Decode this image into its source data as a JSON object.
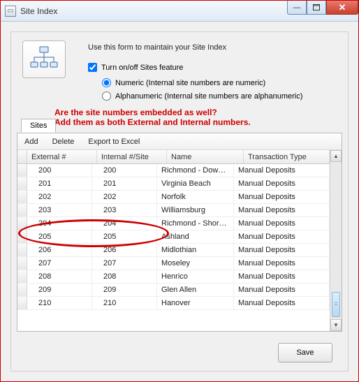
{
  "window": {
    "title": "Site Index"
  },
  "header": {
    "instruction": "Use this form to maintain your Site Index",
    "checkbox_label": "Turn on/off Sites feature",
    "checkbox_checked": true,
    "radio_numeric": "Numeric (Internal site numbers are numeric)",
    "radio_alpha": "Alphanumeric (Internal site numbers are alphanumeric)",
    "radio_selected": "numeric"
  },
  "annotation": {
    "line1": "Are the site numbers embedded as well?",
    "line2": "Add them as both External and Internal numbers."
  },
  "tabs": {
    "sites": "Sites"
  },
  "toolbar": {
    "add": "Add",
    "delete": "Delete",
    "export": "Export to Excel"
  },
  "columns": {
    "ext": "External #",
    "int": "Internal #/Site",
    "name": "Name",
    "tt": "Transaction Type"
  },
  "rows": [
    {
      "ext": "200",
      "int": "200",
      "name": "Richmond - Dow…",
      "tt": "Manual Deposits"
    },
    {
      "ext": "201",
      "int": "201",
      "name": "Virginia Beach",
      "tt": "Manual Deposits"
    },
    {
      "ext": "202",
      "int": "202",
      "name": "Norfolk",
      "tt": "Manual Deposits"
    },
    {
      "ext": "203",
      "int": "203",
      "name": "Williamsburg",
      "tt": "Manual Deposits"
    },
    {
      "ext": "204",
      "int": "204",
      "name": "Richmond - Shor…",
      "tt": "Manual Deposits"
    },
    {
      "ext": "205",
      "int": "205",
      "name": "Ashland",
      "tt": "Manual Deposits"
    },
    {
      "ext": "206",
      "int": "206",
      "name": "Midlothian",
      "tt": "Manual Deposits"
    },
    {
      "ext": "207",
      "int": "207",
      "name": "Moseley",
      "tt": "Manual Deposits"
    },
    {
      "ext": "208",
      "int": "208",
      "name": "Henrico",
      "tt": "Manual Deposits"
    },
    {
      "ext": "209",
      "int": "209",
      "name": "Glen Allen",
      "tt": "Manual Deposits"
    },
    {
      "ext": "210",
      "int": "210",
      "name": "Hanover",
      "tt": "Manual Deposits"
    }
  ],
  "buttons": {
    "save": "Save"
  }
}
